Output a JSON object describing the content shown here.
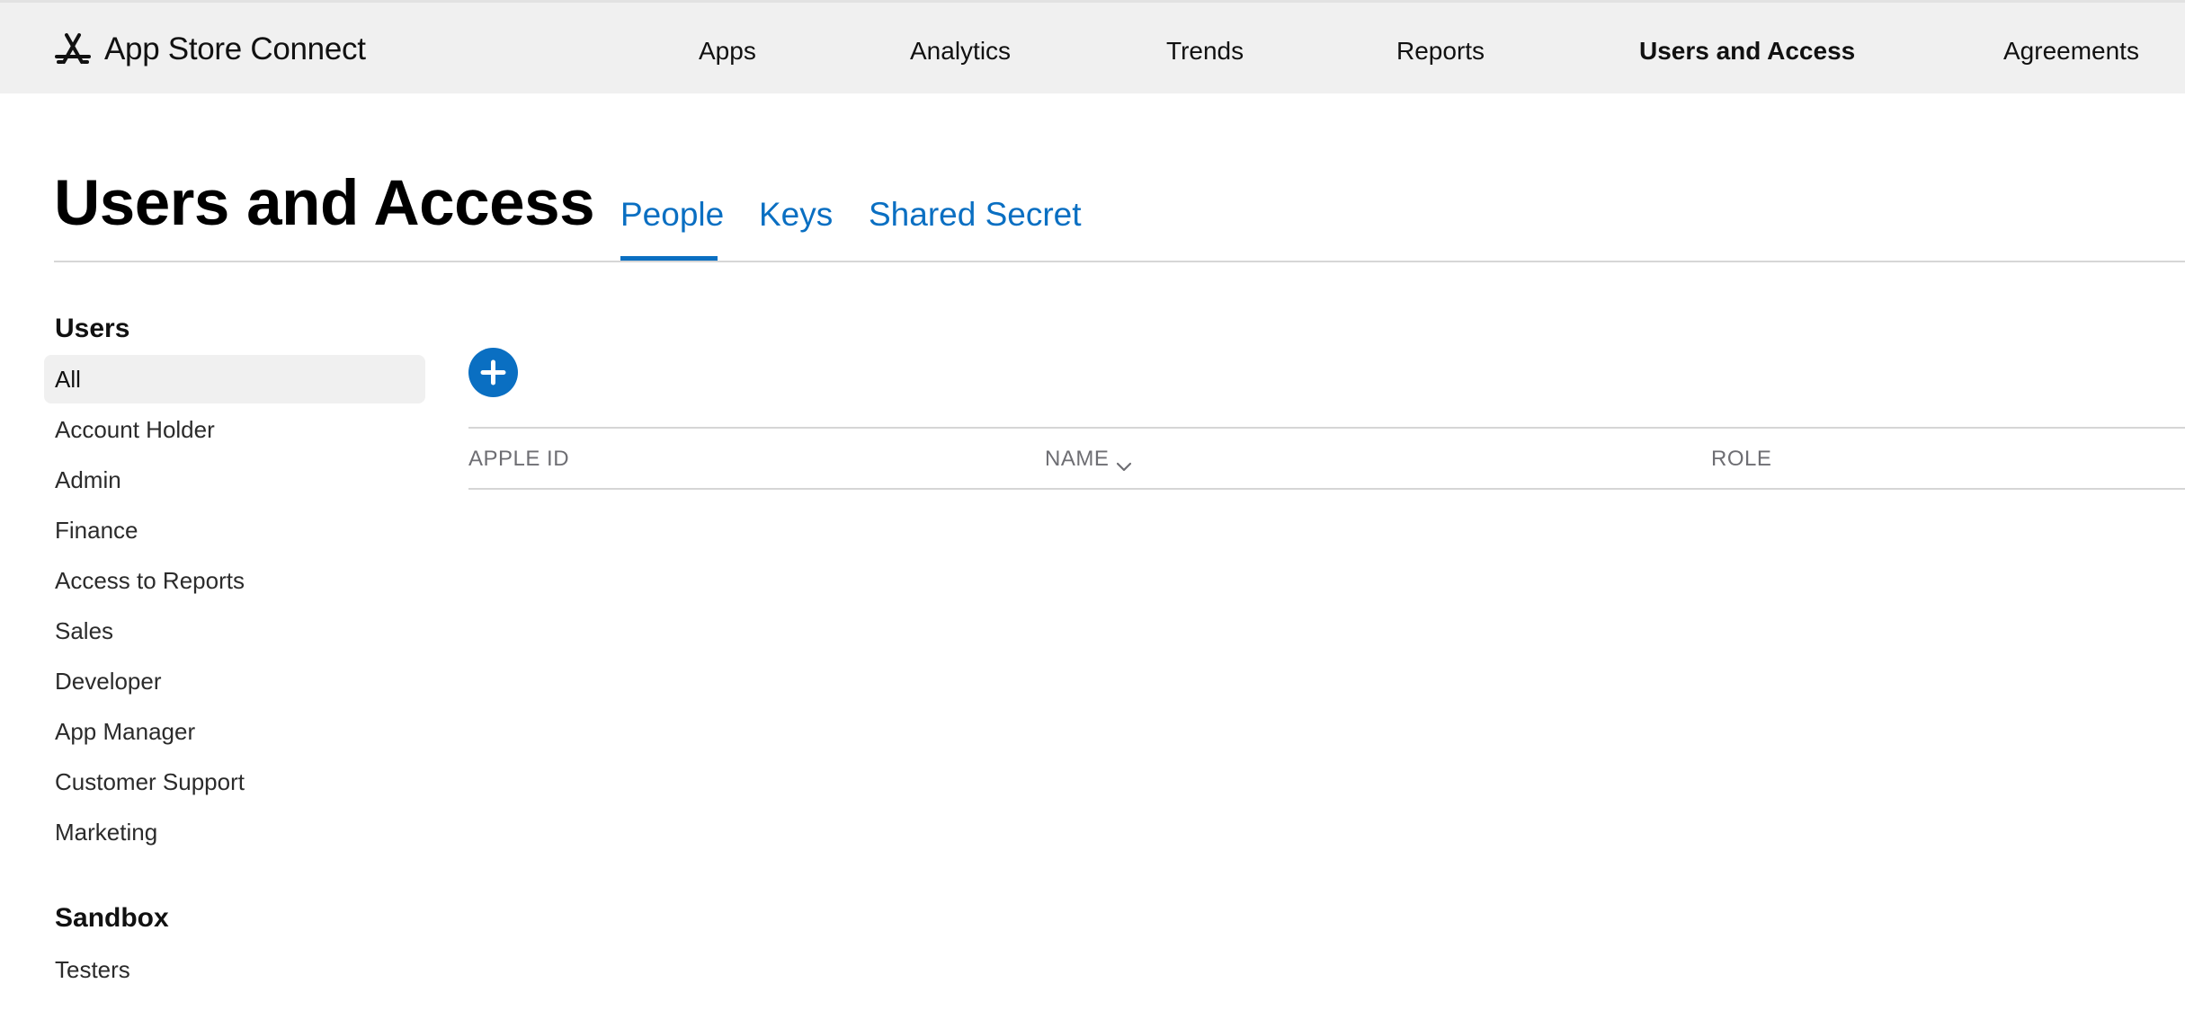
{
  "brand": {
    "label": "App Store Connect",
    "icon": "app-store-icon"
  },
  "topnav": {
    "items": [
      {
        "label": "Apps",
        "active": false
      },
      {
        "label": "Analytics",
        "active": false
      },
      {
        "label": "Trends",
        "active": false
      },
      {
        "label": "Reports",
        "active": false
      },
      {
        "label": "Users and Access",
        "active": true
      },
      {
        "label": "Agreements",
        "active": false
      }
    ]
  },
  "page": {
    "title": "Users and Access",
    "tabs": [
      {
        "label": "People",
        "selected": true
      },
      {
        "label": "Keys",
        "selected": false
      },
      {
        "label": "Shared Secret",
        "selected": false
      }
    ]
  },
  "sidebar": {
    "users_heading": "Users",
    "users_items": [
      {
        "label": "All",
        "selected": true
      },
      {
        "label": "Account Holder",
        "selected": false
      },
      {
        "label": "Admin",
        "selected": false
      },
      {
        "label": "Finance",
        "selected": false
      },
      {
        "label": "Access to Reports",
        "selected": false
      },
      {
        "label": "Sales",
        "selected": false
      },
      {
        "label": "Developer",
        "selected": false
      },
      {
        "label": "App Manager",
        "selected": false
      },
      {
        "label": "Customer Support",
        "selected": false
      },
      {
        "label": "Marketing",
        "selected": false
      }
    ],
    "sandbox_heading": "Sandbox",
    "sandbox_items": [
      {
        "label": "Testers",
        "selected": false
      }
    ]
  },
  "table": {
    "add_icon": "plus-circle-icon",
    "columns": [
      {
        "label": "APPLE ID",
        "sortable": false
      },
      {
        "label": "NAME",
        "sortable": true,
        "sort_icon": "chevron-down-icon"
      },
      {
        "label": "ROLE",
        "sortable": false
      }
    ],
    "rows": []
  },
  "colors": {
    "accent": "#0a6fc2",
    "topbar_bg": "#f0f0f0",
    "selected_item_bg": "#f0f0f0",
    "rule": "#d6d6d6",
    "column_header_text": "#6e6e73"
  }
}
